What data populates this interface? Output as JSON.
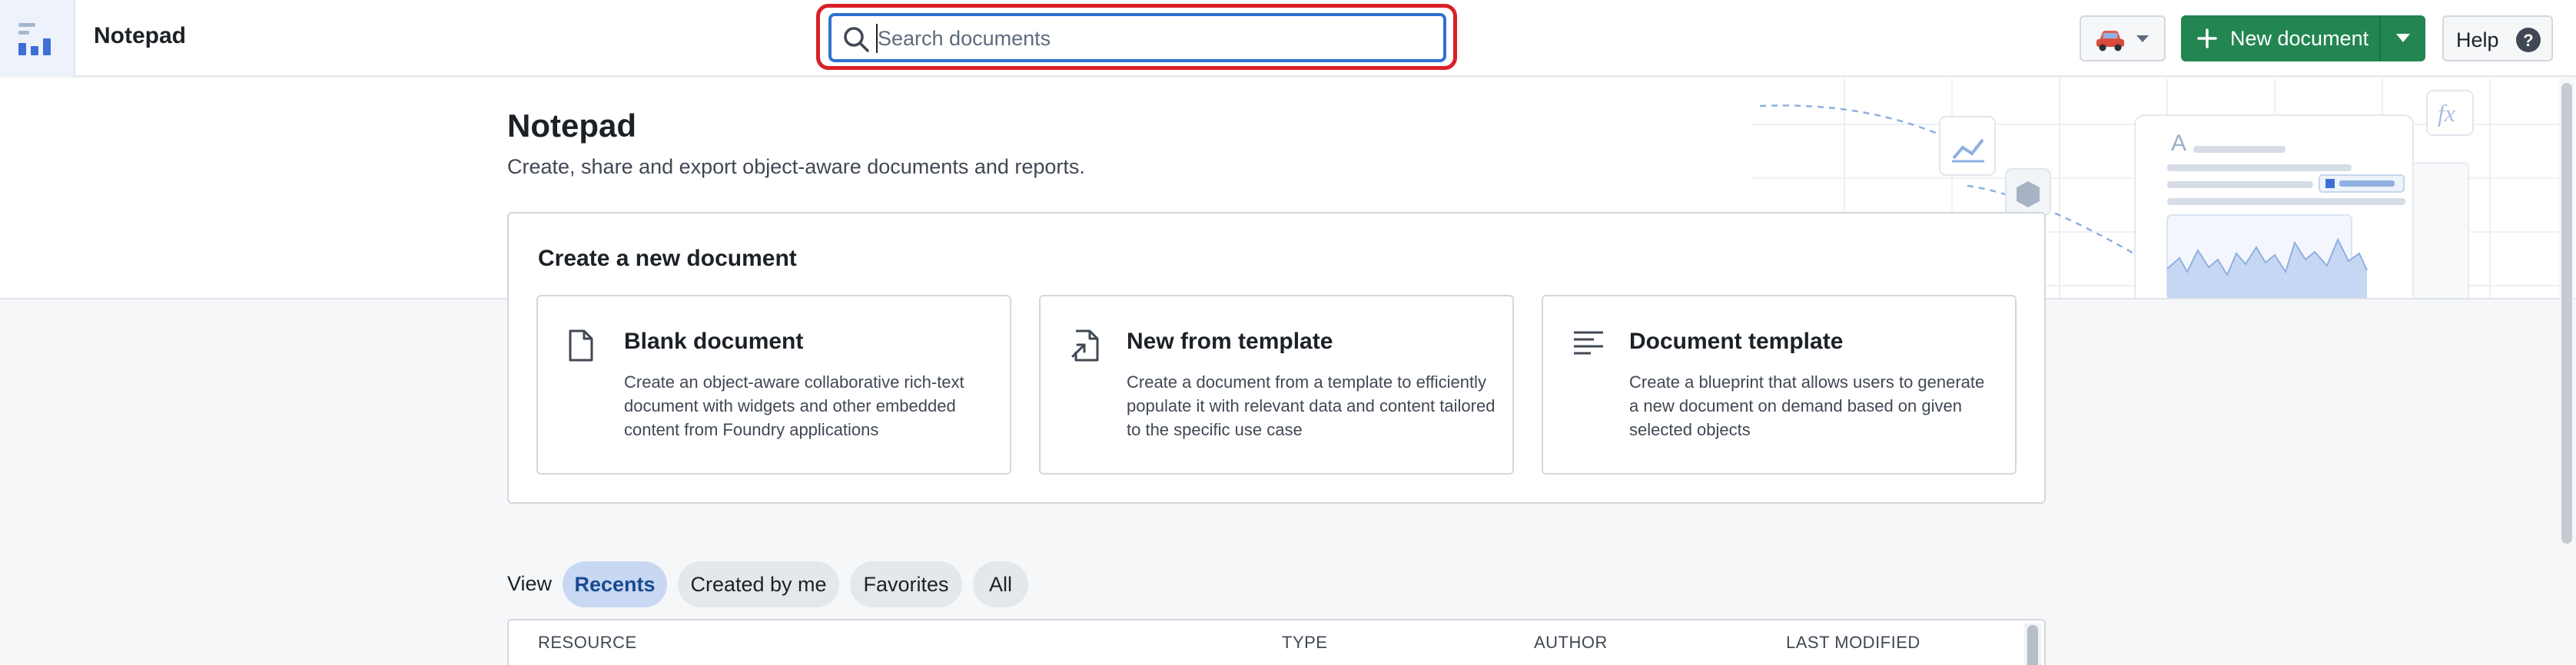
{
  "header": {
    "app_name": "Notepad",
    "search": {
      "placeholder": "Search documents",
      "value": ""
    },
    "new_document_label": "New document",
    "help_label": "Help"
  },
  "hero": {
    "title": "Notepad",
    "subtitle": "Create, share and export object-aware documents and reports."
  },
  "create_section": {
    "heading": "Create a new document",
    "options": [
      {
        "icon": "blank-document-icon",
        "title": "Blank document",
        "description": "Create an object-aware collaborative rich-text document with widgets and other embedded content from Foundry applications"
      },
      {
        "icon": "template-document-icon",
        "title": "New from template",
        "description": "Create a document from a template to efficiently populate it with relevant data and content tailored to the specific use case"
      },
      {
        "icon": "text-lines-icon",
        "title": "Document template",
        "description": "Create a blueprint that allows users to generate a new document on demand based on given selected objects"
      }
    ]
  },
  "view_filters": {
    "label": "View",
    "options": [
      "Recents",
      "Created by me",
      "Favorites",
      "All"
    ],
    "selected": "Recents"
  },
  "table": {
    "columns": [
      "RESOURCE",
      "TYPE",
      "AUTHOR",
      "LAST MODIFIED"
    ]
  },
  "colors": {
    "primary_green": "#238551",
    "focus_blue": "#2d72d2",
    "highlight_red": "#d92027",
    "active_pill": "#c8d7f2"
  }
}
